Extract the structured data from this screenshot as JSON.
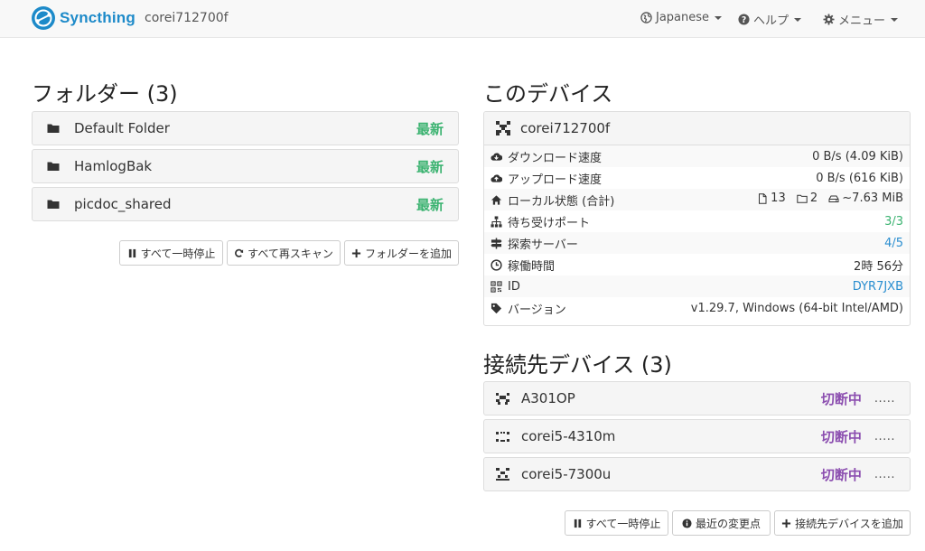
{
  "navbar": {
    "brand": "Syncthing",
    "hostname": "corei712700f",
    "language": "Japanese",
    "help": "ヘルプ",
    "menu": "メニュー"
  },
  "folders": {
    "heading": "フォルダー (3)",
    "items": [
      {
        "label": "Default Folder",
        "status": "最新"
      },
      {
        "label": "HamlogBak",
        "status": "最新"
      },
      {
        "label": "picdoc_shared",
        "status": "最新"
      }
    ],
    "buttons": {
      "pause_all": "すべて一時停止",
      "rescan_all": "すべて再スキャン",
      "add_folder": "フォルダーを追加"
    }
  },
  "this_device": {
    "heading": "このデバイス",
    "name": "corei712700f",
    "rows": {
      "download": {
        "label": "ダウンロード速度",
        "value": "0 B/s (4.09 KiB)"
      },
      "upload": {
        "label": "アップロード速度",
        "value": "0 B/s (616 KiB)"
      },
      "local_state": {
        "label": "ローカル状態 (合計)",
        "files": "13",
        "dirs": "2",
        "size": "~7.63 MiB"
      },
      "listeners": {
        "label": "待ち受けポート",
        "value": "3/3"
      },
      "discovery": {
        "label": "探索サーバー",
        "value": "4/5"
      },
      "uptime": {
        "label": "稼働時間",
        "value": "2時 56分"
      },
      "id": {
        "label": "ID",
        "value": "DYR7JXB"
      },
      "version": {
        "label": "バージョン",
        "value": "v1.29.7, Windows (64-bit Intel/AMD)"
      }
    }
  },
  "remote_devices": {
    "heading": "接続先デバイス (3)",
    "items": [
      {
        "label": "A301OP",
        "status": "切断中",
        "more": "....."
      },
      {
        "label": "corei5-4310m",
        "status": "切断中",
        "more": "....."
      },
      {
        "label": "corei5-7300u",
        "status": "切断中",
        "more": "....."
      }
    ],
    "buttons": {
      "pause_all": "すべて一時停止",
      "recent_changes": "最近の変更点",
      "add_device": "接続先デバイスを追加"
    }
  },
  "colors": {
    "brand": "#1d8ac9",
    "up_to_date": "#3cb371",
    "disconnected": "#8c4fb0",
    "link": "#2a8ed0"
  }
}
